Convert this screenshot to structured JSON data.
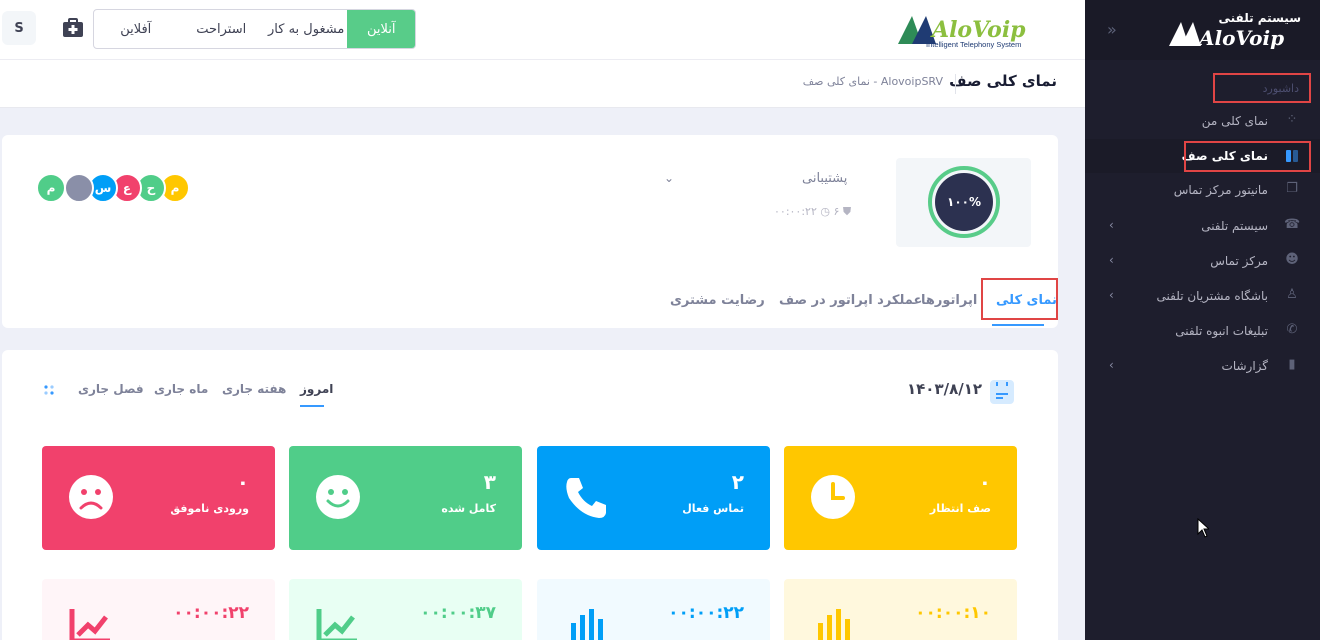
{
  "header": {
    "user_initial": "S",
    "status_buttons": [
      "آنلاین",
      "مشغول به کار",
      "استراحت",
      "آفلاین"
    ],
    "brand_logo_text": "AloVoip",
    "brand_tagline": "Intelligent Telephony System"
  },
  "subheader": {
    "title": "نمای کلی صف",
    "breadcrumb": [
      "AlovoipSRV",
      "نمای کلی صف"
    ]
  },
  "sidebar": {
    "logo_caption": "سیستم تلفنی",
    "logo_text": "AloVoip",
    "section_label": "داشبورد",
    "items": [
      {
        "label": "نمای کلی من",
        "icon": "dashboard-icon"
      },
      {
        "label": "نمای کلی صف",
        "icon": "queue-icon"
      },
      {
        "label": "مانیتور مرکز تماس",
        "icon": "monitor-icon"
      },
      {
        "label": "سیستم تلفنی",
        "icon": "phone-system-icon"
      },
      {
        "label": "مرکز تماس",
        "icon": "contact-center-icon"
      },
      {
        "label": "باشگاه مشتریان تلفنی",
        "icon": "customer-club-icon"
      },
      {
        "label": "تبلیغات انبوه تلفنی",
        "icon": "phone-icon"
      },
      {
        "label": "گزارشات",
        "icon": "reports-icon"
      }
    ]
  },
  "queue": {
    "progress": "۱۰۰%",
    "progress_fraction": 1.0,
    "name": "پشتیبانی",
    "members": "۶",
    "wait_time": "۰۰:۰۰:۲۲",
    "avatars": [
      {
        "initial": "م",
        "color": "#ffc700"
      },
      {
        "initial": "ح",
        "color": "#50cd89"
      },
      {
        "initial": "ع",
        "color": "#f1416c"
      },
      {
        "initial": "س",
        "color": "#009ef7"
      },
      {
        "initial": "",
        "color": "#7e8299"
      },
      {
        "initial": "م",
        "color": "#50cd89"
      }
    ],
    "tabs": [
      "نمای کلی",
      "اپراتورها",
      "عملکرد اپراتور در صف",
      "رضایت مشتری"
    ]
  },
  "stats": {
    "date": "۱۴۰۳/۸/۱۲",
    "periods": [
      "امروز",
      "هفته جاری",
      "ماه جاری",
      "فصل جاری"
    ],
    "tiles": [
      {
        "value": "۰",
        "label": "صف انتظار",
        "color": "#ffc700",
        "icon": "clock-icon"
      },
      {
        "value": "۲",
        "label": "تماس فعال",
        "color": "#009ef7",
        "icon": "phone-icon"
      },
      {
        "value": "۳",
        "label": "کامل شده",
        "color": "#50cd89",
        "icon": "smile-icon"
      },
      {
        "value": "۰",
        "label": "ورودی ناموفق",
        "color": "#f1416c",
        "icon": "sad-icon"
      }
    ],
    "durations": [
      {
        "value": "۰۰:۰۰:۱۰",
        "color": "#ffc700",
        "bg": "#fff8dd",
        "icon": "bar-chart-icon"
      },
      {
        "value": "۰۰:۰۰:۲۲",
        "color": "#009ef7",
        "bg": "#f1faff",
        "icon": "bar-chart-icon"
      },
      {
        "value": "۰۰:۰۰:۳۷",
        "color": "#50cd89",
        "bg": "#e8fff3",
        "icon": "trend-up-icon"
      },
      {
        "value": "۰۰:۰۰:۲۲",
        "color": "#f1416c",
        "bg": "#fff5f8",
        "icon": "trend-up-icon"
      }
    ]
  }
}
